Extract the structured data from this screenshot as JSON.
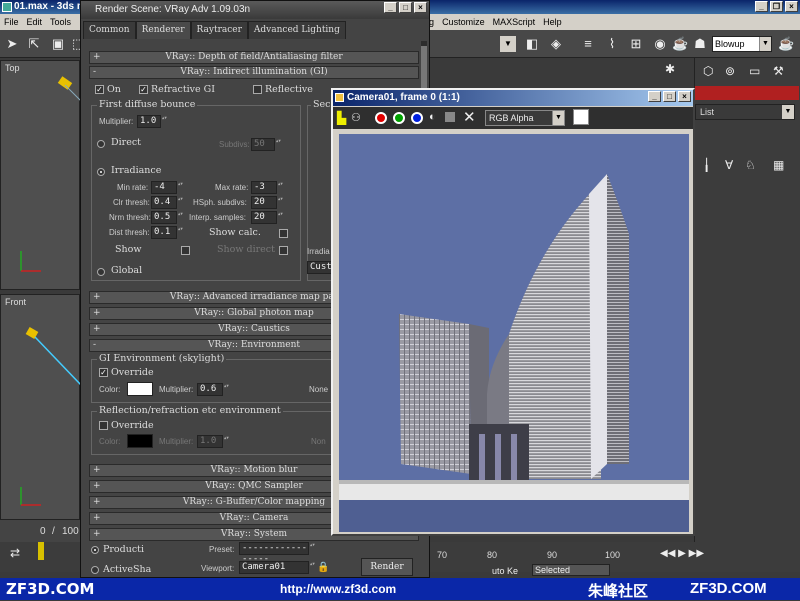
{
  "main_window": {
    "title": "01.max - 3ds m",
    "menu": [
      "File",
      "Edit",
      "Tools",
      "ring",
      "Customize",
      "MAXScript",
      "Help"
    ],
    "viewport_top_label": "Top",
    "viewport_front_label": "Front",
    "blowup_select": "Blowup",
    "list_label": "List",
    "timeline": {
      "frame": "0",
      "sep": "/",
      "total": "100"
    },
    "ruler": [
      "70",
      "80",
      "90",
      "100"
    ],
    "auto_key": "uto Ke",
    "selected": "Selected"
  },
  "render_dialog": {
    "title": "Render Scene: VRay Adv 1.09.03n",
    "tabs": [
      "Common",
      "Renderer",
      "Raytracer",
      "Advanced Lighting"
    ],
    "rollout_dof": "VRay:: Depth of field/Antialiasing filter",
    "rollout_gi": "VRay:: Indirect illumination (GI)",
    "on_label": "On",
    "refractive_gi": "Refractive GI",
    "reflective_gi": "Reflective",
    "first_bounce": "First diffuse bounce",
    "second_bounce": "Sec",
    "multiplier_label": "Multiplier:",
    "multiplier_value": "1.0",
    "direct": "Direct",
    "subdivs_label": "Subdivs:",
    "subdivs_value": "50",
    "irradiance": "Irradiance",
    "min_rate_label": "Min rate:",
    "min_rate": "-4",
    "max_rate_label": "Max rate:",
    "max_rate": "-3",
    "clr_thresh_label": "Clr thresh:",
    "clr_thresh": "0.4",
    "hsph_label": "HSph. subdivs:",
    "hsph": "20",
    "nrm_thresh_label": "Nrm thresh:",
    "nrm_thresh": "0.5",
    "interp_label": "Interp. samples:",
    "interp": "20",
    "dist_thresh_label": "Dist thresh:",
    "dist_thresh": "0.1",
    "show_calc": "Show calc.",
    "show": "Show",
    "show_direct": "Show direct",
    "global": "Global",
    "irradia_label": "Irradia",
    "custom_label": "Custo",
    "rollout_adv_irr": "VRay:: Advanced irradiance map par",
    "rollout_photon": "VRay:: Global photon map",
    "rollout_caustics": "VRay:: Caustics",
    "rollout_env": "VRay:: Environment",
    "gi_env": "GI Environment (skylight)",
    "override": "Override",
    "color_label": "Color:",
    "env_multiplier": "0.6",
    "none_label": "None",
    "refl_env": "Reflection/refraction etc environment",
    "override2": "Override",
    "refl_multiplier": "1.0",
    "none2_label": "Non",
    "rollout_motion": "VRay:: Motion blur",
    "rollout_qmc": "VRay:: QMC Sampler",
    "rollout_gbuffer": "VRay:: G-Buffer/Color mapping",
    "rollout_camera": "VRay:: Camera",
    "rollout_system": "VRay:: System",
    "production": "Producti",
    "activeshade": "ActiveSha",
    "preset_label": "Preset:",
    "preset_value": "-----------------",
    "viewport_label": "Viewport:",
    "viewport_value": "Camera01",
    "render_button": "Render"
  },
  "camera_window": {
    "title": "Camera01, frame 0 (1:1)",
    "channel": "RGB Alpha"
  },
  "footer": {
    "left": "ZF3D.COM",
    "url": "http://www.zf3d.com",
    "cn": "朱峰社区",
    "right": "ZF3D.COM"
  },
  "colors": {
    "sky": "#5d6fa5",
    "red_channel": "#e00000",
    "green_channel": "#00a000",
    "blue_channel": "#0020e0"
  }
}
